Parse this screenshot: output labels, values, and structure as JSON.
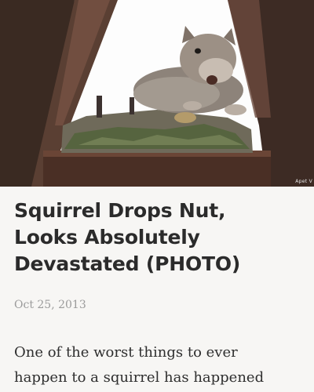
{
  "article": {
    "image_credit": "Apet V",
    "headline_lines": [
      "Squirrel Drops Nut,",
      "Looks Absolutely",
      "Devastated (PHOTO)"
    ],
    "date": "Oct 25, 2013",
    "body_lines": [
      "One of the worst things to ever",
      "happen to a squirrel has happened"
    ]
  }
}
